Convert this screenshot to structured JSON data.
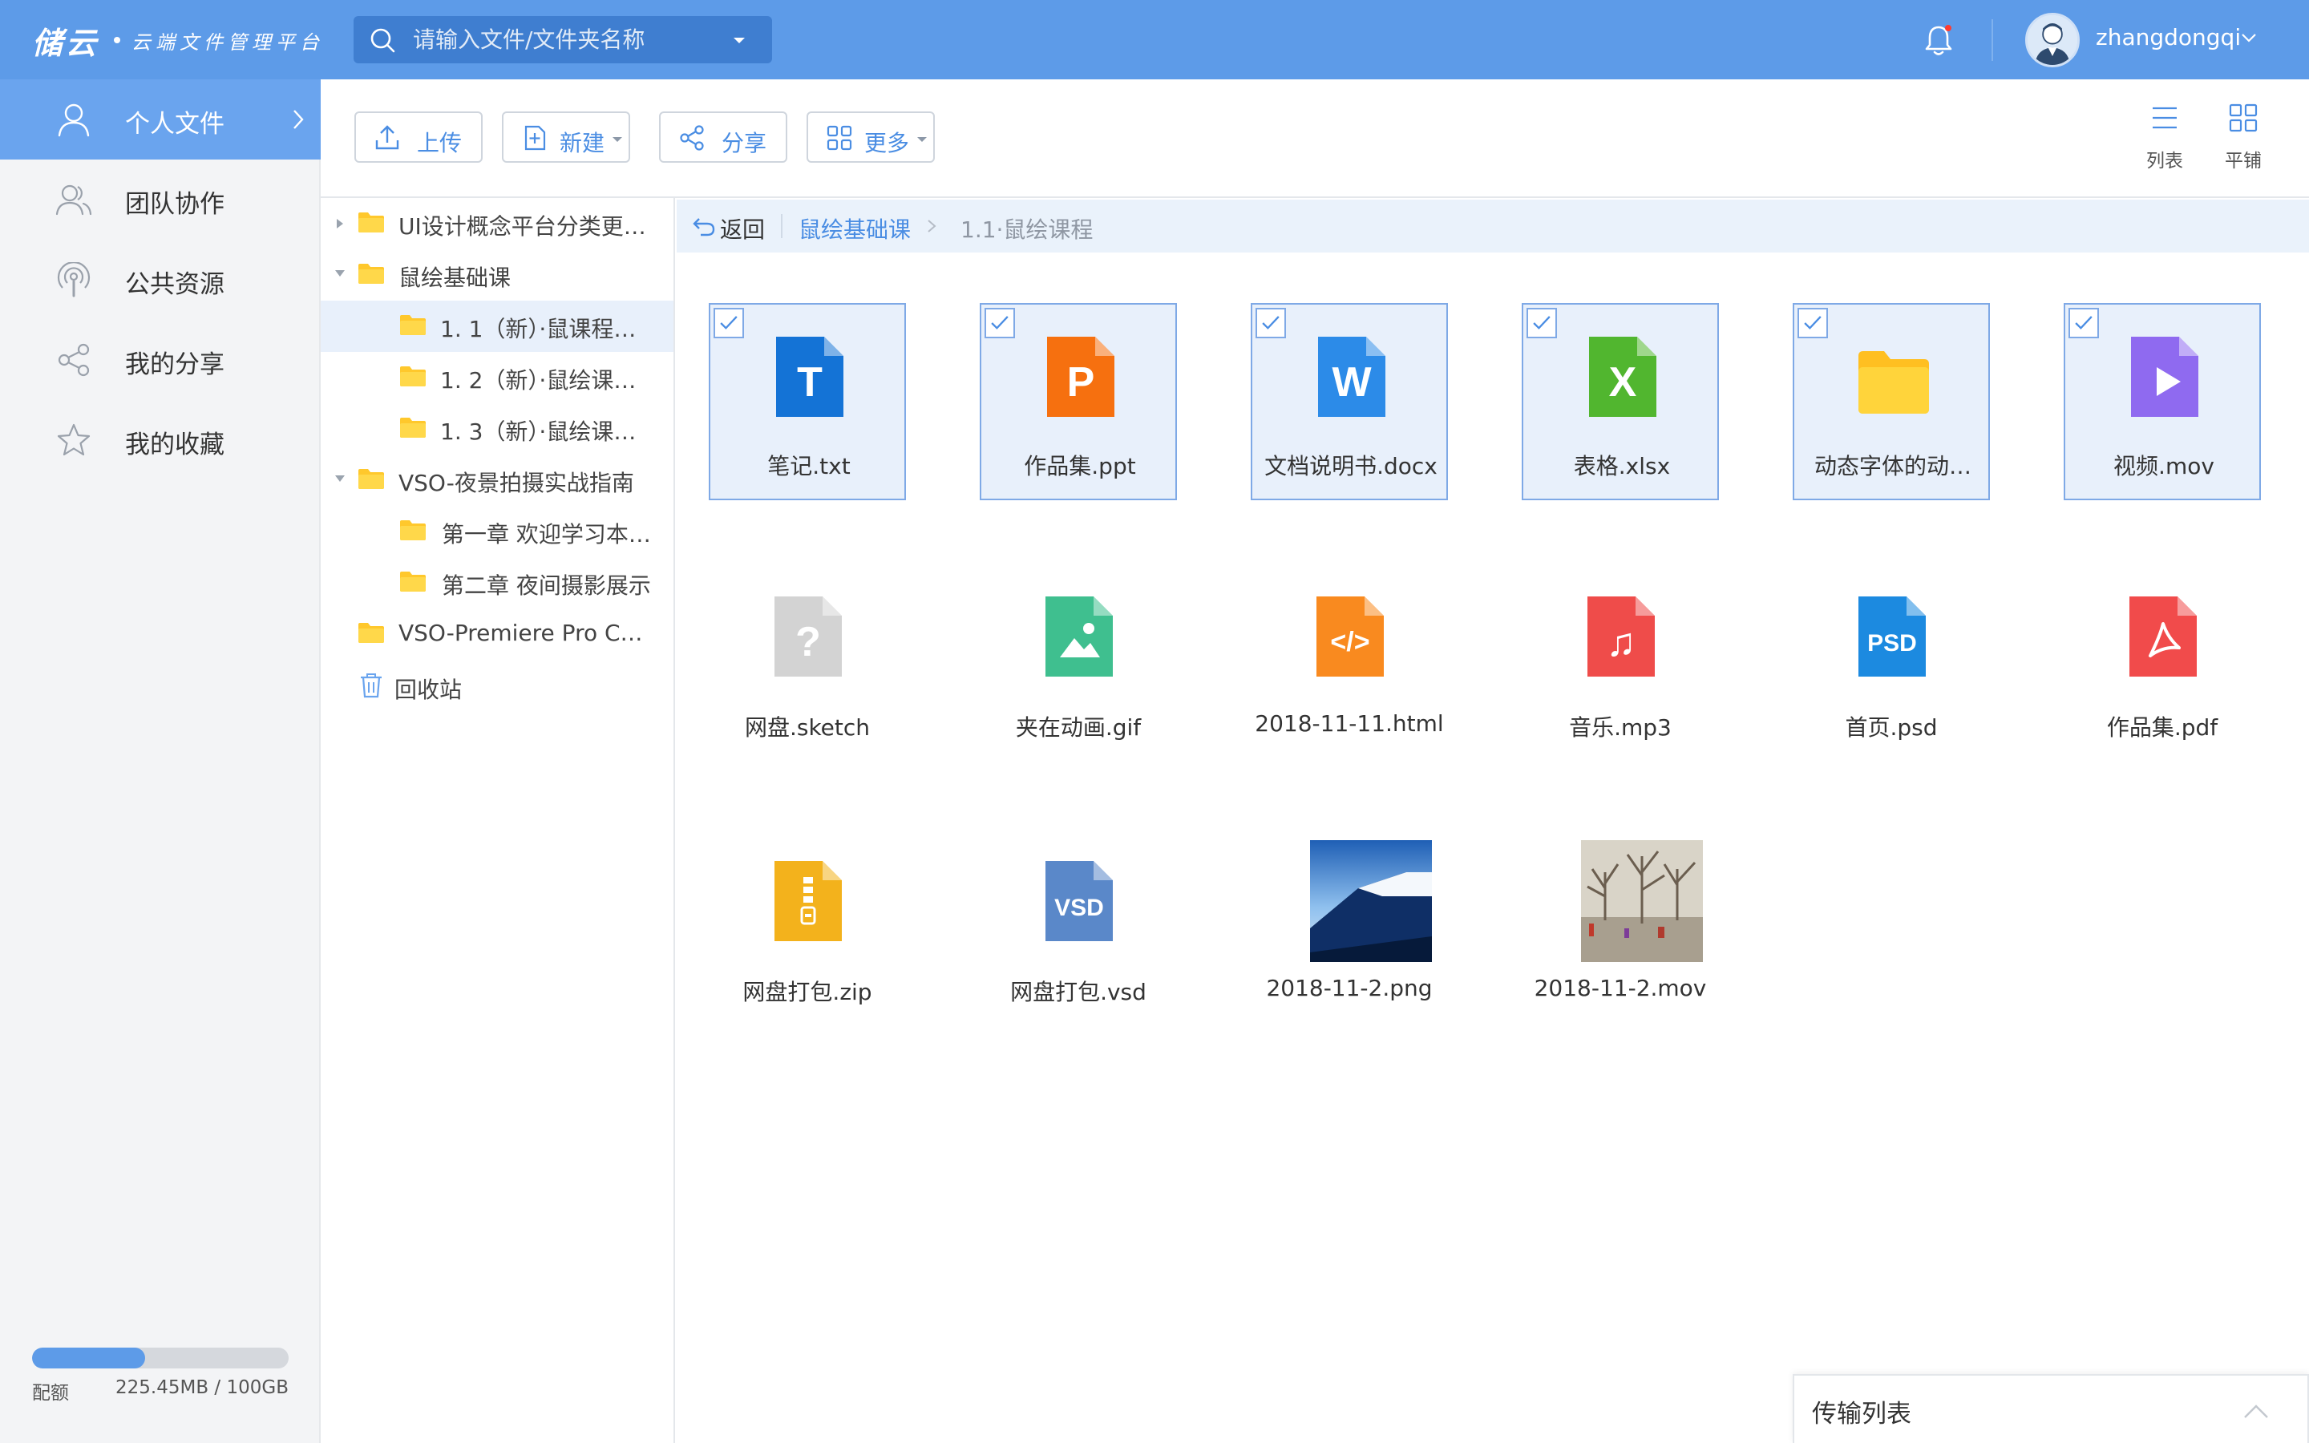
{
  "app": {
    "logo_main": "储云",
    "logo_sub": "云端文件管理平台"
  },
  "search": {
    "placeholder": "请输入文件/文件夹名称",
    "value": ""
  },
  "user": {
    "name": "zhangdongqi",
    "has_notification": true
  },
  "sidebar": {
    "items": [
      {
        "label": "个人文件",
        "icon": "user-icon",
        "active": true
      },
      {
        "label": "团队协作",
        "icon": "team-icon",
        "active": false
      },
      {
        "label": "公共资源",
        "icon": "podcast-icon",
        "active": false
      },
      {
        "label": "我的分享",
        "icon": "share-icon",
        "active": false
      },
      {
        "label": "我的收藏",
        "icon": "star-icon",
        "active": false
      }
    ],
    "quota": {
      "label": "配额",
      "value": "225.45MB / 100GB",
      "fill_fraction": 0.44
    }
  },
  "toolbar": {
    "upload": "上传",
    "new": "新建",
    "share": "分享",
    "more": "更多",
    "view_list": "列表",
    "view_grid": "平铺"
  },
  "tree": {
    "items": [
      {
        "label": "UI设计概念平台分类更…",
        "level": 0,
        "expanded": false,
        "kind": "folder"
      },
      {
        "label": "鼠绘基础课",
        "level": 0,
        "expanded": true,
        "kind": "folder"
      },
      {
        "label": "1. 1（新）·鼠课程…",
        "level": 1,
        "selected": true,
        "kind": "folder"
      },
      {
        "label": "1. 2（新）·鼠绘课…",
        "level": 1,
        "kind": "folder"
      },
      {
        "label": "1. 3（新）·鼠绘课…",
        "level": 1,
        "kind": "folder"
      },
      {
        "label": "VSO-夜景拍摄实战指南",
        "level": 0,
        "expanded": true,
        "kind": "folder"
      },
      {
        "label": "第一章 欢迎学习本…",
        "level": 1,
        "kind": "folder"
      },
      {
        "label": "第二章 夜间摄影展示",
        "level": 1,
        "kind": "folder"
      },
      {
        "label": "VSO-Premiere Pro C…",
        "level": 0,
        "kind": "folder"
      },
      {
        "label": "回收站",
        "level": 0,
        "kind": "trash"
      }
    ]
  },
  "breadcrumb": {
    "back": "返回",
    "crumbs": [
      "鼠绘基础课",
      "1.1·鼠绘课程"
    ]
  },
  "files": [
    {
      "name": "笔记.txt",
      "type": "txt",
      "glyph": "T",
      "color": "#1473d6",
      "selected": true
    },
    {
      "name": "作品集.ppt",
      "type": "ppt",
      "glyph": "P",
      "color": "#f6700f",
      "selected": true
    },
    {
      "name": "文档说明书.docx",
      "type": "docx",
      "glyph": "W",
      "color": "#2c8be8",
      "selected": true
    },
    {
      "name": "表格.xlsx",
      "type": "xlsx",
      "glyph": "X",
      "color": "#51b62f",
      "selected": true
    },
    {
      "name": "动态字体的动…",
      "type": "folder",
      "glyph": "",
      "color": "#ffcb2f",
      "selected": true
    },
    {
      "name": "视频.mov",
      "type": "video",
      "glyph": "▶",
      "color": "#8f6af0",
      "selected": true
    },
    {
      "name": "网盘.sketch",
      "type": "unknown",
      "glyph": "?",
      "color": "#d3d3d3",
      "selected": false
    },
    {
      "name": "夹在动画.gif",
      "type": "image",
      "glyph": "",
      "color": "#3fbf8f",
      "selected": false
    },
    {
      "name": "2018-11-11.html",
      "type": "code",
      "glyph": "</>",
      "color": "#f98a1f",
      "selected": false
    },
    {
      "name": "音乐.mp3",
      "type": "audio",
      "glyph": "♫",
      "color": "#ef4c4a",
      "selected": false
    },
    {
      "name": "首页.psd",
      "type": "psd",
      "glyph": "PSD",
      "color": "#1c8ae0",
      "selected": false
    },
    {
      "name": "作品集.pdf",
      "type": "pdf",
      "glyph": "",
      "color": "#f14b4b",
      "selected": false
    },
    {
      "name": "网盘打包.zip",
      "type": "zip",
      "glyph": "",
      "color": "#f3b21c",
      "selected": false
    },
    {
      "name": "网盘打包.vsd",
      "type": "vsd",
      "glyph": "VSD",
      "color": "#5a88c9",
      "selected": false
    },
    {
      "name": "2018-11-2.png",
      "type": "photo-sky",
      "glyph": "",
      "color": "#3a6fb8",
      "selected": false
    },
    {
      "name": "2018-11-2.mov",
      "type": "photo-street",
      "glyph": "",
      "color": "#b9b2a4",
      "selected": false
    }
  ],
  "transfer": {
    "label": "传输列表"
  },
  "colors": {
    "accent": "#5d9be8",
    "nav_active": "#6aa4ee",
    "link": "#4a8de3"
  }
}
